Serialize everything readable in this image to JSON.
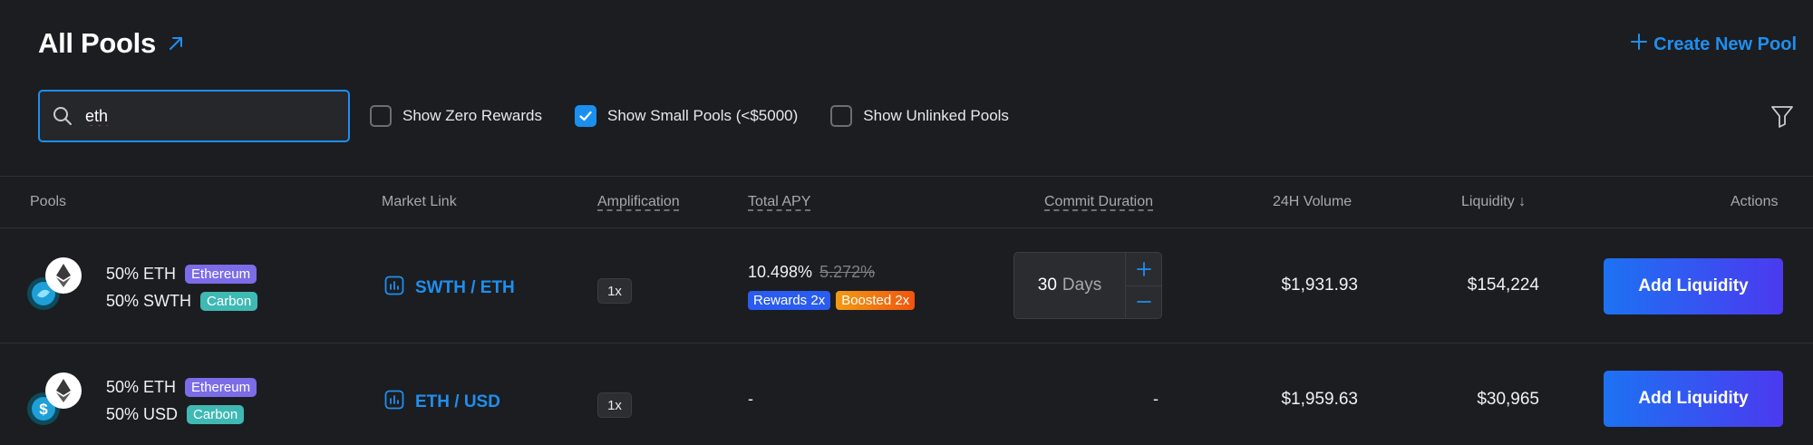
{
  "header": {
    "title": "All Pools",
    "create_label": "Create New Pool"
  },
  "filters": {
    "search_value": "eth",
    "checkboxes": [
      {
        "label": "Show Zero Rewards",
        "checked": false
      },
      {
        "label": "Show Small Pools (<$5000)",
        "checked": true
      },
      {
        "label": "Show Unlinked Pools",
        "checked": false
      }
    ]
  },
  "table": {
    "columns": {
      "pools": "Pools",
      "market_link": "Market Link",
      "amplification": "Amplification",
      "total_apy": "Total APY",
      "commit_duration": "Commit Duration",
      "volume_24h": "24H Volume",
      "liquidity": "Liquidity ↓",
      "actions": "Actions"
    },
    "rows": [
      {
        "token_a": "50% ETH",
        "token_a_tag": "Ethereum",
        "token_b": "50% SWTH",
        "token_b_tag": "Carbon",
        "market": "SWTH / ETH",
        "amplification": "1x",
        "apy": "10.498%",
        "apy_old": "5.272%",
        "badge_rewards": "Rewards 2x",
        "badge_boosted": "Boosted 2x",
        "commit_value": "30",
        "commit_unit": "Days",
        "volume": "$1,931.93",
        "liquidity": "$154,224",
        "action": "Add Liquidity"
      },
      {
        "token_a": "50% ETH",
        "token_a_tag": "Ethereum",
        "token_b": "50% USD",
        "token_b_tag": "Carbon",
        "market": "ETH / USD",
        "amplification": "1x",
        "apy": "-",
        "commit": "-",
        "volume": "$1,959.63",
        "liquidity": "$30,965",
        "action": "Add Liquidity"
      }
    ]
  },
  "colors": {
    "accent": "#1f8ff0",
    "background": "#1c1d20",
    "ethereum_tag": "#7b6ce8",
    "carbon_tag": "#3fb9b3"
  },
  "icons": [
    "external-link-icon",
    "plus-icon",
    "search-icon",
    "check-icon",
    "filter-icon",
    "ethereum-icon",
    "swth-icon",
    "usd-icon",
    "chart-icon"
  ]
}
